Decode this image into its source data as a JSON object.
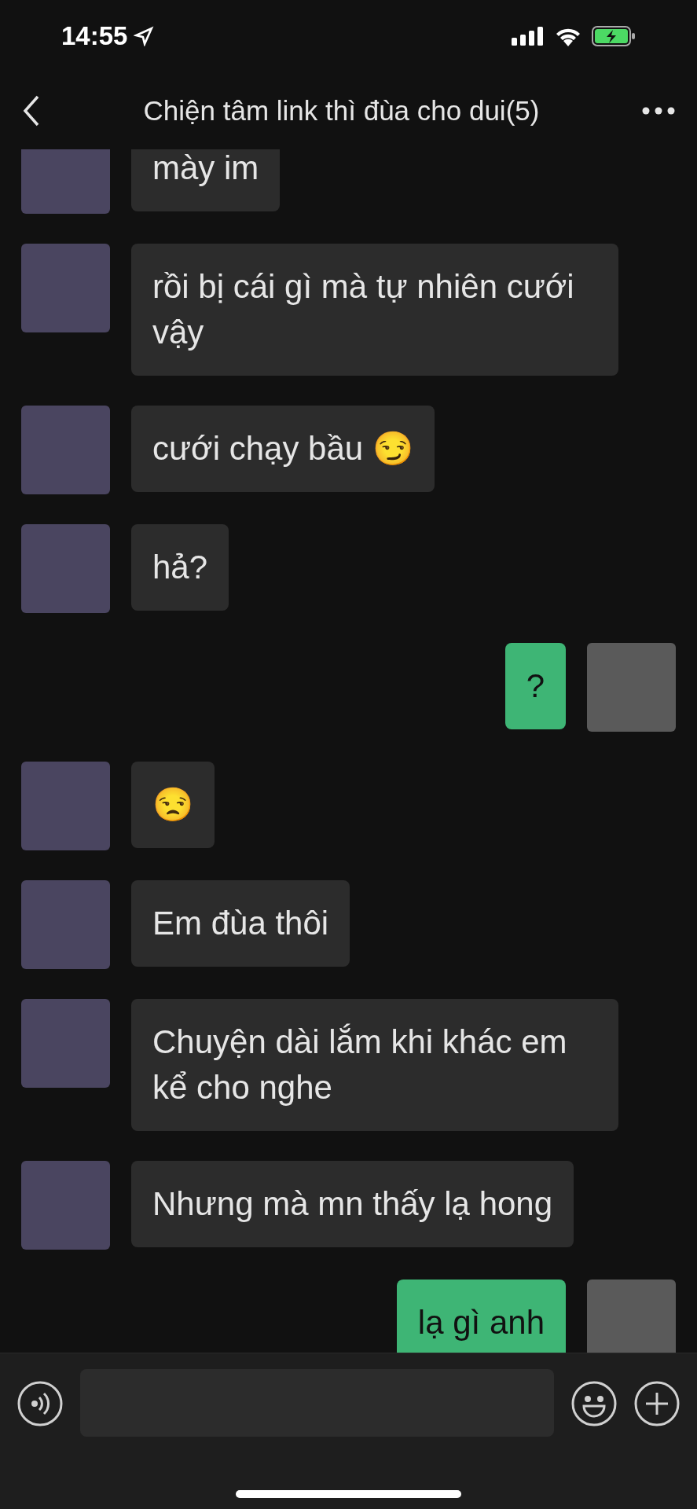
{
  "status_bar": {
    "time": "14:55"
  },
  "header": {
    "title": "Chiện tâm link thì đùa cho dui(5)"
  },
  "messages": [
    {
      "kind": "incoming",
      "text": "mày im"
    },
    {
      "kind": "incoming",
      "text": "rồi bị cái gì mà tự nhiên cưới vậy"
    },
    {
      "kind": "incoming",
      "text": "cưới chạy bầu 😏"
    },
    {
      "kind": "incoming",
      "text": "hả?"
    },
    {
      "kind": "outgoing",
      "text": "?"
    },
    {
      "kind": "incoming",
      "text": "😒"
    },
    {
      "kind": "incoming",
      "text": "Em đùa thôi"
    },
    {
      "kind": "incoming",
      "text": "Chuyện dài lắm khi khác em kể cho nghe"
    },
    {
      "kind": "incoming",
      "text": "Nhưng mà mn thấy lạ hong"
    },
    {
      "kind": "outgoing",
      "text": "lạ gì anh"
    }
  ]
}
